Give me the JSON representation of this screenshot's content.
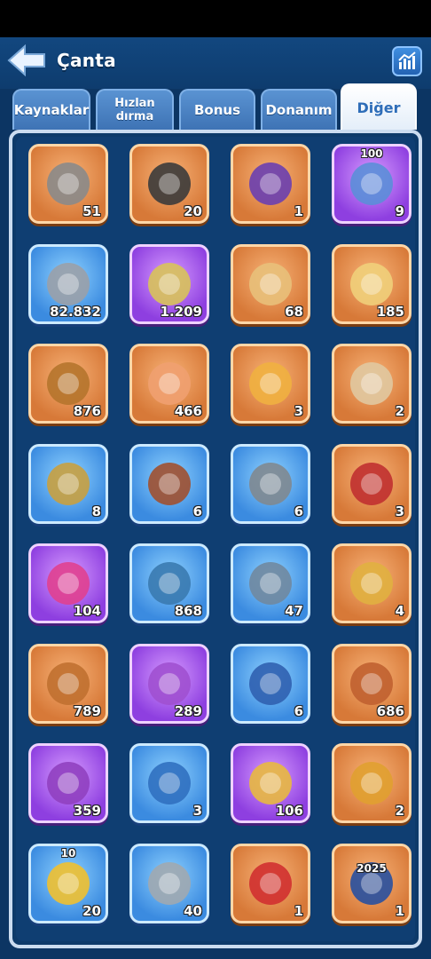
{
  "header": {
    "title": "Çanta"
  },
  "tabs": [
    {
      "label": "Kaynaklar",
      "active": false
    },
    {
      "label": "Hızlan dırma",
      "active": false
    },
    {
      "label": "Bonus",
      "active": false
    },
    {
      "label": "Donanım",
      "active": false
    },
    {
      "label": "Diğer",
      "active": true
    }
  ],
  "items": [
    {
      "name": "stone-icon",
      "rarity": "orange",
      "count": "51"
    },
    {
      "name": "telescope-puzzle-icon",
      "rarity": "orange",
      "count": "20"
    },
    {
      "name": "purple-crystal-icon",
      "rarity": "orange",
      "count": "1"
    },
    {
      "name": "blue-gear-icon",
      "rarity": "purple",
      "count": "9",
      "top": "100"
    },
    {
      "name": "silver-ingot-icon",
      "rarity": "blue",
      "count": "82.832"
    },
    {
      "name": "potion-bottle-icon",
      "rarity": "purple",
      "count": "1.209"
    },
    {
      "name": "scroll-icon",
      "rarity": "orange",
      "count": "68"
    },
    {
      "name": "recipe-paper-icon",
      "rarity": "orange",
      "count": "185"
    },
    {
      "name": "orange-book-icon",
      "rarity": "orange",
      "count": "876"
    },
    {
      "name": "scales-ticket-icon",
      "rarity": "orange",
      "count": "466"
    },
    {
      "name": "fish-ticket-icon",
      "rarity": "orange",
      "count": "3"
    },
    {
      "name": "treasure-map-icon",
      "rarity": "orange",
      "count": "2"
    },
    {
      "name": "helmet-icon",
      "rarity": "blue",
      "count": "8"
    },
    {
      "name": "robot-drone-icon",
      "rarity": "blue",
      "count": "6"
    },
    {
      "name": "fishing-reel-icon",
      "rarity": "blue",
      "count": "6"
    },
    {
      "name": "syringe-icon",
      "rarity": "orange",
      "count": "3"
    },
    {
      "name": "pet-potion-icon",
      "rarity": "purple",
      "count": "104"
    },
    {
      "name": "paw-book-icon",
      "rarity": "blue",
      "count": "868"
    },
    {
      "name": "blue-ore-icon",
      "rarity": "blue",
      "count": "47"
    },
    {
      "name": "gold-ticket-icon",
      "rarity": "orange",
      "count": "4"
    },
    {
      "name": "orange-skill-book-icon",
      "rarity": "orange",
      "count": "789"
    },
    {
      "name": "purple-skill-book-icon",
      "rarity": "purple",
      "count": "289"
    },
    {
      "name": "blue-skill-book-icon",
      "rarity": "blue",
      "count": "6"
    },
    {
      "name": "orange-flag-book-icon",
      "rarity": "orange",
      "count": "686"
    },
    {
      "name": "purple-flag-book-icon",
      "rarity": "purple",
      "count": "359"
    },
    {
      "name": "blue-flag-book-icon",
      "rarity": "blue",
      "count": "3"
    },
    {
      "name": "golden-key-icon",
      "rarity": "purple",
      "count": "106"
    },
    {
      "name": "gold-coupon-icon",
      "rarity": "orange",
      "count": "2"
    },
    {
      "name": "gold-chevron-icon",
      "rarity": "blue",
      "count": "20",
      "top": "10"
    },
    {
      "name": "dagger-icon",
      "rarity": "blue",
      "count": "40"
    },
    {
      "name": "second-place-medal-icon",
      "rarity": "orange",
      "count": "1"
    },
    {
      "name": "calendar-2025-book-icon",
      "rarity": "orange",
      "count": "1",
      "label": "2025"
    }
  ],
  "colors": {
    "background": "#0c3563",
    "orange": "#d77938",
    "blue": "#3b8be0",
    "purple": "#8e3fe0"
  }
}
